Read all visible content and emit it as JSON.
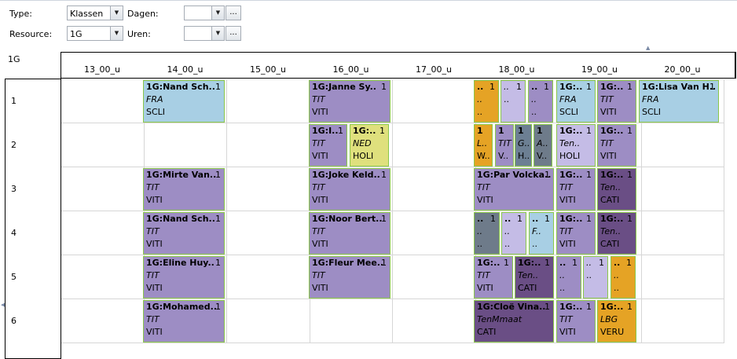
{
  "filters": {
    "type_label": "Type:",
    "type_value": "Klassen",
    "resource_label": "Resource:",
    "resource_value": "1G",
    "dagen_label": "Dagen:",
    "dagen_value": "",
    "uren_label": "Uren:",
    "uren_value": "",
    "ellipsis": "..."
  },
  "group_label": "1G",
  "columns": [
    "13_00_u",
    "14_00_u",
    "15_00_u",
    "16_00_u",
    "17_00_u",
    "18_00_u",
    "19_00_u",
    "20_00_u"
  ],
  "rows": [
    "1",
    "2",
    "3",
    "4",
    "5",
    "6"
  ],
  "appointments": [
    {
      "row": 0,
      "title": "1G:Nand Sch..",
      "num": "1",
      "subject": "FRA",
      "room": "SCLI",
      "color": "#a8cfe4"
    },
    {
      "row": 0,
      "title": "1G:Janne Sy..",
      "num": "1",
      "subject": "TIT",
      "room": "VITI",
      "color": "#9d8dc4"
    },
    {
      "row": 0,
      "title": "..",
      "num": "1",
      "subject": "..",
      "room": "..",
      "color": "#e5a325"
    },
    {
      "row": 0,
      "title": "",
      "num": "1",
      "subject": "..",
      "room": "..",
      "color": "#c4bce6"
    },
    {
      "row": 0,
      "title": "..",
      "num": "1",
      "subject": "..",
      "room": "..",
      "color": "#9d8dc4"
    },
    {
      "row": 0,
      "title": "1G:..",
      "num": "1",
      "subject": "FRA",
      "room": "SCLI",
      "color": "#a8cfe4"
    },
    {
      "row": 0,
      "title": "1G:..",
      "num": "1",
      "subject": "TIT",
      "room": "VITI",
      "color": "#9d8dc4"
    },
    {
      "row": 0,
      "title": "1G:Lisa Van H..",
      "num": "1",
      "subject": "FRA",
      "room": "SCLI",
      "color": "#a8cfe4"
    },
    {
      "row": 1,
      "title": "1G:I..",
      "num": "1",
      "subject": "TIT",
      "room": "VITI",
      "color": "#9d8dc4"
    },
    {
      "row": 1,
      "title": "1G:..",
      "num": "1",
      "subject": "NED",
      "room": "HOLI",
      "color": "#dfe07d"
    },
    {
      "row": 1,
      "title": "1",
      "num": "",
      "subject": "L..",
      "room": "W..",
      "color": "#e5a325"
    },
    {
      "row": 1,
      "title": "1",
      "num": "",
      "subject": "TIT",
      "room": "V..",
      "color": "#9d8dc4"
    },
    {
      "row": 1,
      "title": "1",
      "num": "",
      "subject": "G..",
      "room": "H..",
      "color": "#6c7f93"
    },
    {
      "row": 1,
      "title": "1",
      "num": "",
      "subject": "A..",
      "room": "V..",
      "color": "#6e7b8a"
    },
    {
      "row": 1,
      "title": "1G:..",
      "num": "1",
      "subject": "Ten..",
      "room": "HOLI",
      "color": "#c4bce6"
    },
    {
      "row": 1,
      "title": "1G:..",
      "num": "1",
      "subject": "TIT",
      "room": "VITI",
      "color": "#9d8dc4"
    },
    {
      "row": 2,
      "title": "1G:Mirte Van..",
      "num": "1",
      "subject": "TIT",
      "room": "VITI",
      "color": "#9d8dc4"
    },
    {
      "row": 2,
      "title": "1G:Joke Keld..",
      "num": "1",
      "subject": "TIT",
      "room": "VITI",
      "color": "#9d8dc4"
    },
    {
      "row": 2,
      "title": "1G:Par Volcka..",
      "num": "1",
      "subject": "TIT",
      "room": "VITI",
      "color": "#9d8dc4"
    },
    {
      "row": 2,
      "title": "1G:..",
      "num": "1",
      "subject": "TIT",
      "room": "VITI",
      "color": "#9d8dc4"
    },
    {
      "row": 2,
      "title": "1G:..",
      "num": "1",
      "subject": "Ten..",
      "room": "CATI",
      "color": "#6a4e85"
    },
    {
      "row": 3,
      "title": "1G:Nand Sch..",
      "num": "1",
      "subject": "TIT",
      "room": "VITI",
      "color": "#9d8dc4"
    },
    {
      "row": 3,
      "title": "1G:Noor Bert..",
      "num": "1",
      "subject": "TIT",
      "room": "VITI",
      "color": "#9d8dc4"
    },
    {
      "row": 3,
      "title": "..",
      "num": "1",
      "subject": "..",
      "room": "..",
      "color": "#6e7b8a"
    },
    {
      "row": 3,
      "title": "..",
      "num": "1",
      "subject": "..",
      "room": "..",
      "color": "#c4bce6"
    },
    {
      "row": 3,
      "title": "..",
      "num": "1",
      "subject": "F..",
      "room": "..",
      "color": "#a8cfe4"
    },
    {
      "row": 3,
      "title": "1G:..",
      "num": "1",
      "subject": "TIT",
      "room": "VITI",
      "color": "#9d8dc4"
    },
    {
      "row": 3,
      "title": "1G:..",
      "num": "1",
      "subject": "Ten..",
      "room": "CATI",
      "color": "#6a4e85"
    },
    {
      "row": 4,
      "title": "1G:Eline Huy..",
      "num": "1",
      "subject": "TIT",
      "room": "VITI",
      "color": "#9d8dc4"
    },
    {
      "row": 4,
      "title": "1G:Fleur Mee..",
      "num": "1",
      "subject": "TIT",
      "room": "VITI",
      "color": "#9d8dc4"
    },
    {
      "row": 4,
      "title": "1G:..",
      "num": "1",
      "subject": "TIT",
      "room": "VITI",
      "color": "#9d8dc4"
    },
    {
      "row": 4,
      "title": "1G:..",
      "num": "1",
      "subject": "Ten..",
      "room": "CATI",
      "color": "#6a4e85"
    },
    {
      "row": 4,
      "title": "..",
      "num": "1",
      "subject": "..",
      "room": "..",
      "color": "#9d8dc4"
    },
    {
      "row": 4,
      "title": "",
      "num": "1",
      "subject": "..",
      "room": "..",
      "color": "#c4bce6"
    },
    {
      "row": 4,
      "title": "..",
      "num": "1",
      "subject": "..",
      "room": "..",
      "color": "#e5a325"
    },
    {
      "row": 5,
      "title": "1G:Mohamed..",
      "num": "1",
      "subject": "TIT",
      "room": "VITI",
      "color": "#9d8dc4"
    },
    {
      "row": 5,
      "title": "1G:Cloë Vina..",
      "num": "1",
      "subject": "TenMmaat",
      "room": "CATI",
      "color": "#6a4e85"
    },
    {
      "row": 5,
      "title": "1G:..",
      "num": "1",
      "subject": "TIT",
      "room": "VITI",
      "color": "#9d8dc4"
    },
    {
      "row": 5,
      "title": "1G:..",
      "num": "1",
      "subject": "LBG",
      "room": "VERU",
      "color": "#e5a325"
    }
  ]
}
